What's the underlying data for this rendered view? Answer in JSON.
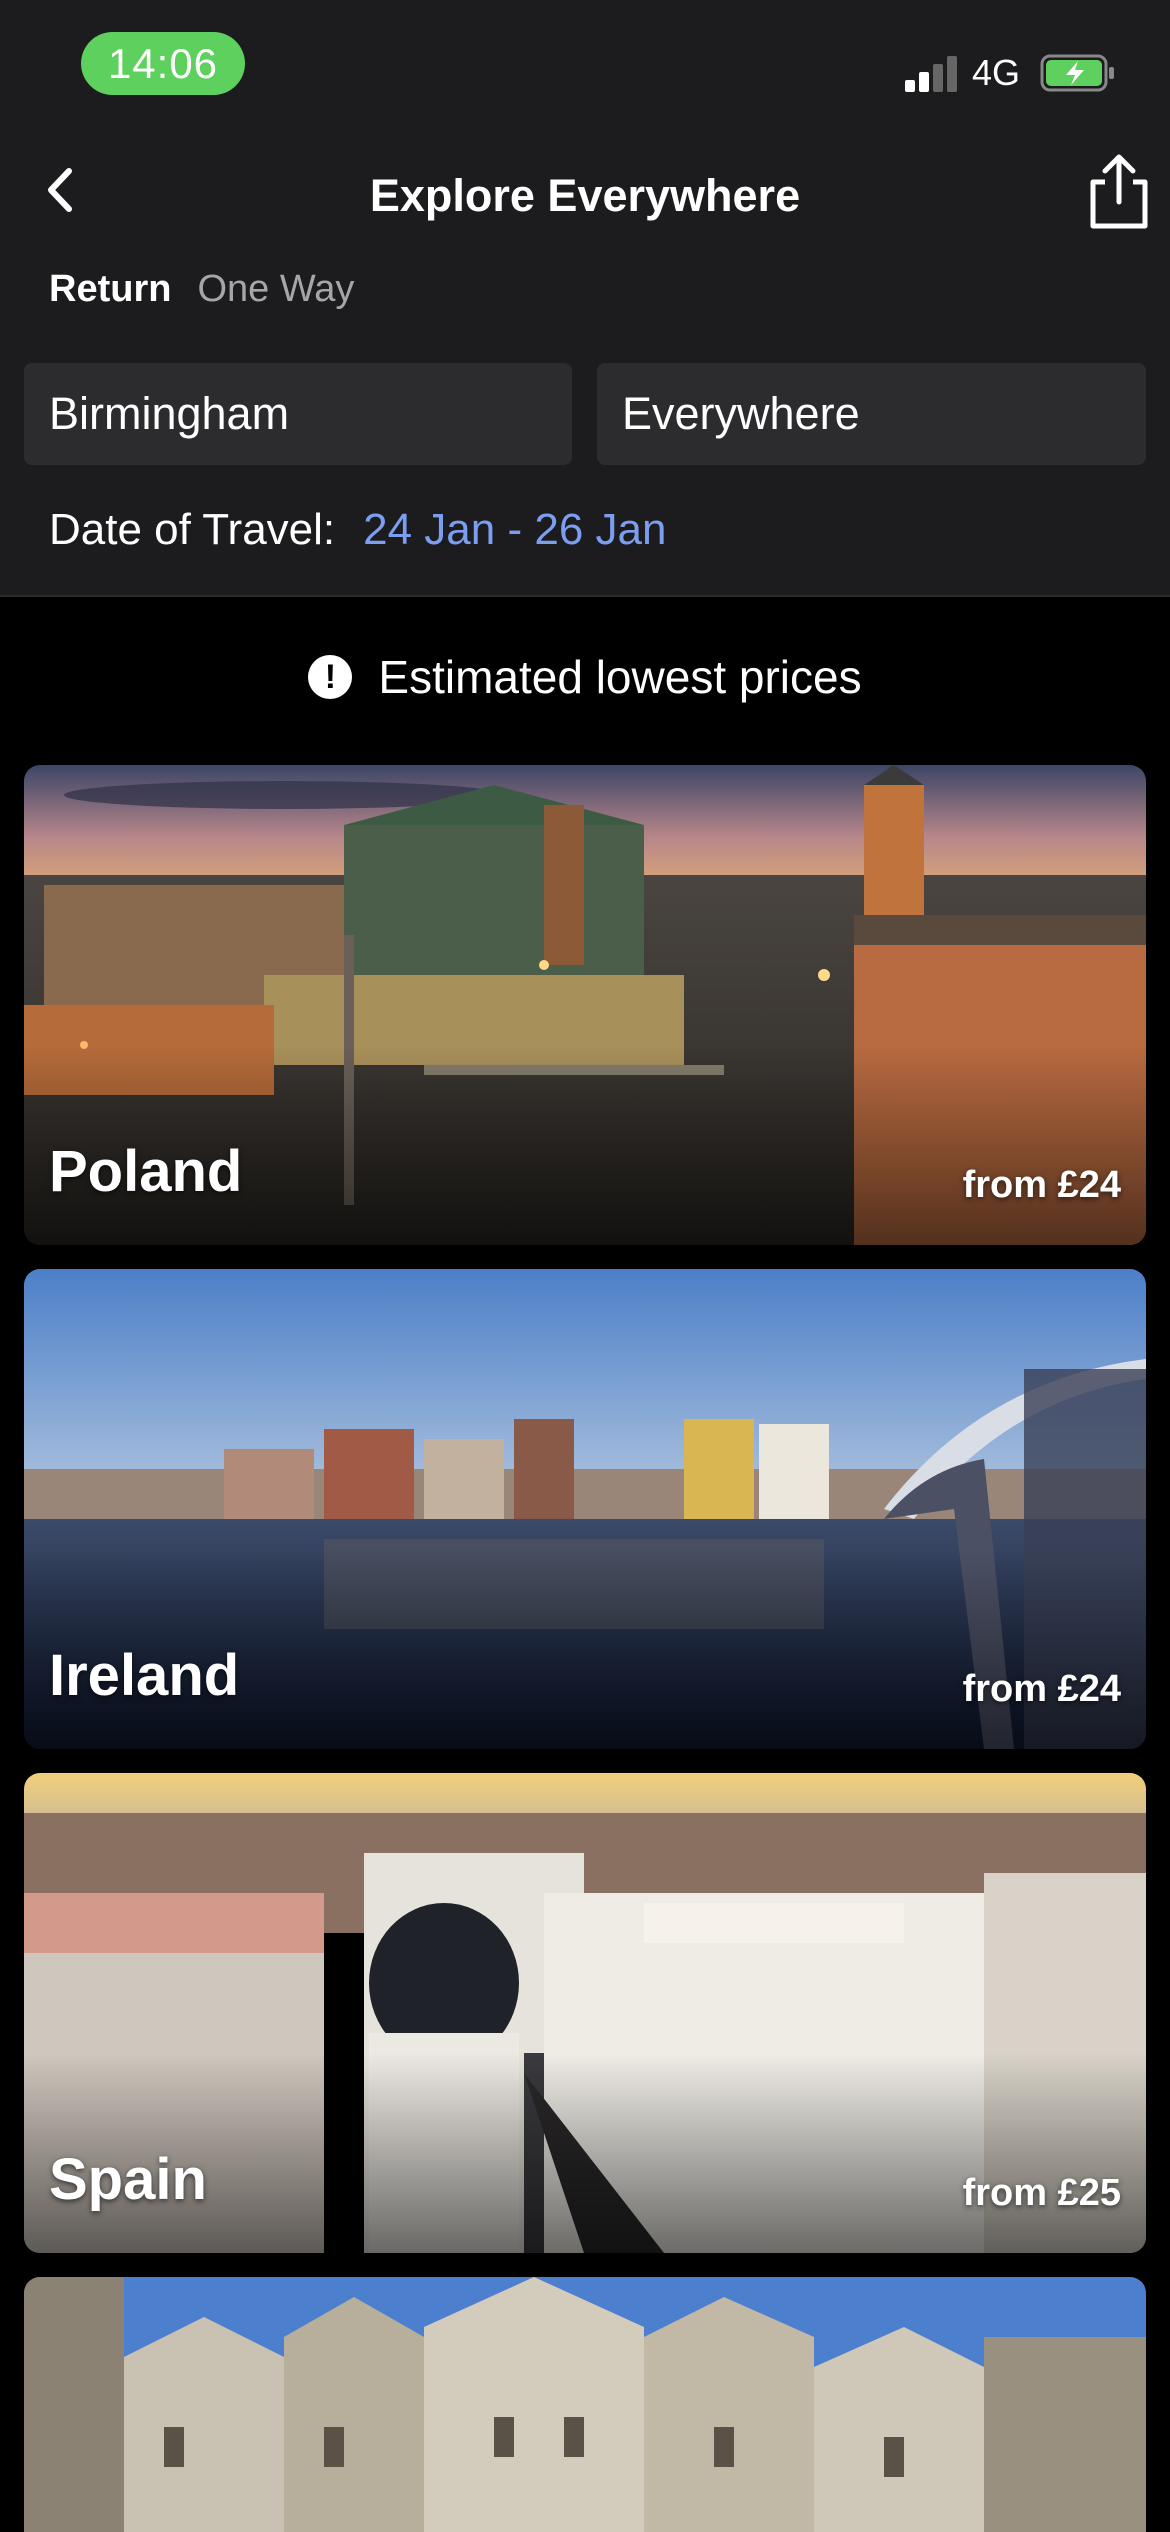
{
  "status_bar": {
    "time": "14:06",
    "network": "4G"
  },
  "header": {
    "title": "Explore Everywhere",
    "trip_types": {
      "active": "Return",
      "inactive": "One Way"
    },
    "origin": "Birmingham",
    "destination": "Everywhere",
    "date_label": "Date of Travel:",
    "date_value": "24 Jan - 26 Jan"
  },
  "notice": {
    "text": "Estimated lowest prices",
    "icon": "exclamation-circle-icon"
  },
  "destinations": [
    {
      "country": "Poland",
      "price": "from £24"
    },
    {
      "country": "Ireland",
      "price": "from £24"
    },
    {
      "country": "Spain",
      "price": "from £25"
    },
    {
      "country": "",
      "price": ""
    }
  ],
  "colors": {
    "accent": "#7b9ef0",
    "status_pill": "#5ed05d",
    "header_bg": "#1c1c1e",
    "field_bg": "#2c2c2e"
  }
}
